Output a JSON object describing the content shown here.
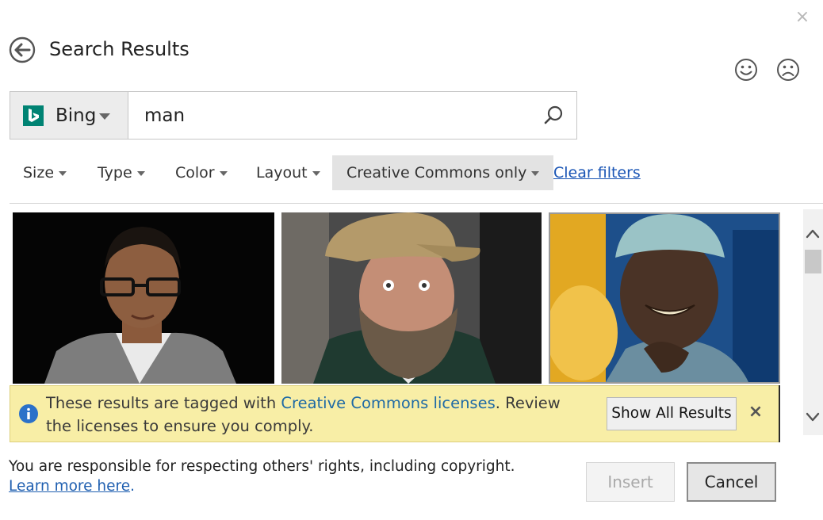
{
  "window": {
    "close_glyph": "×"
  },
  "header": {
    "title": "Search Results"
  },
  "feedback": {
    "smile_icon": "smile-icon",
    "frown_icon": "frown-icon"
  },
  "search": {
    "engine_label": "Bing",
    "query": "man"
  },
  "filters": [
    {
      "label": "Size"
    },
    {
      "label": "Type"
    },
    {
      "label": "Color"
    },
    {
      "label": "Layout"
    },
    {
      "label": "Creative Commons only"
    }
  ],
  "clear_filters_label": "Clear filters",
  "info_bar": {
    "text_before": "These results are tagged with ",
    "link_text": "Creative Commons licenses",
    "text_after": ". Review the licenses to ensure you comply.",
    "button_label": "Show All Results",
    "close_glyph": "×"
  },
  "footer": {
    "rights_text": "You are responsible for respecting others' rights, including copyright.",
    "learn_more_label": "Learn more here",
    "learn_more_suffix": "."
  },
  "buttons": {
    "insert": "Insert",
    "cancel": "Cancel"
  },
  "colors": {
    "bing_teal": "#008373",
    "info_bar_bg": "#f8eea6",
    "link_blue": "#1a55b5",
    "info_icon_blue": "#2b71c9"
  }
}
